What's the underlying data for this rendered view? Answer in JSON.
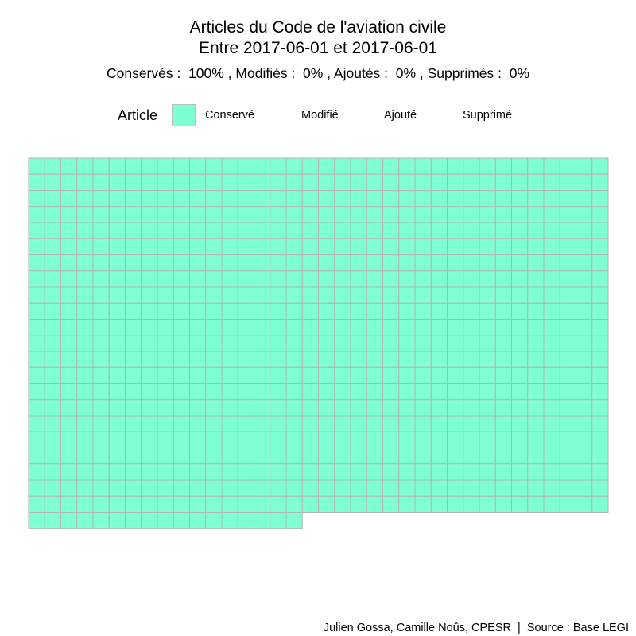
{
  "chart_data": {
    "type": "waffle",
    "title_lines": [
      "Articles du Code de l'aviation civile",
      "Entre 2017-06-01 et 2017-06-01"
    ],
    "subtitle": "Conservés :  100% , Modifiés :  0% , Ajoutés :  0% , Supprimés :  0%",
    "percentages": {
      "Conservés": 100,
      "Modifiés": 0,
      "Ajoutés": 0,
      "Supprimés": 0
    },
    "legend": {
      "title": "Article",
      "entries": [
        {
          "label": "Conservé",
          "color": "#7fffd4"
        },
        {
          "label": "Modifié",
          "color": null
        },
        {
          "label": "Ajouté",
          "color": null
        },
        {
          "label": "Supprimé",
          "color": null
        }
      ]
    },
    "grid": {
      "columns": 36,
      "full_rows": 22,
      "partial_row_cells": 17
    },
    "series": [
      {
        "category": "Conservé",
        "count": 809,
        "color": "#7fffd4"
      }
    ],
    "tile_border_color": "#b3b3b3"
  },
  "caption": "Julien Gossa, Camille Noûs, CPESR  |  Source : Base LEGI"
}
